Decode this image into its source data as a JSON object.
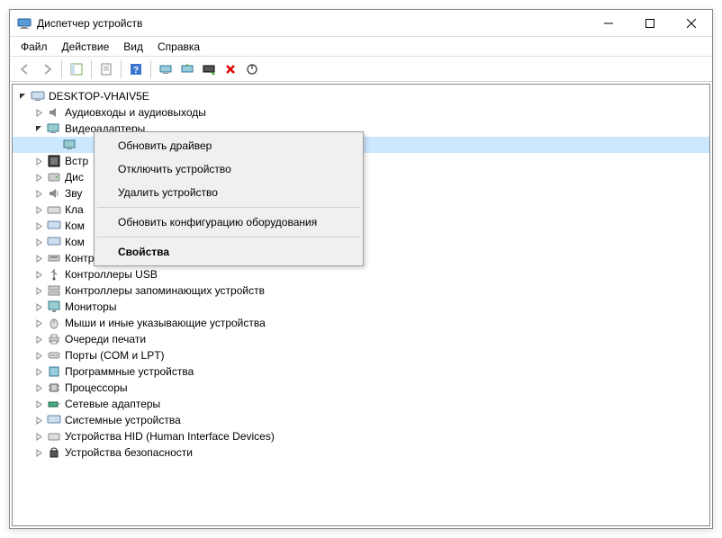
{
  "window": {
    "title": "Диспетчер устройств"
  },
  "menu": {
    "file": "Файл",
    "action": "Действие",
    "view": "Вид",
    "help": "Справка"
  },
  "tree": {
    "root": "DESKTOP-VHAIV5E",
    "nodes": [
      "Аудиовходы и аудиовыходы",
      "Видеоадаптеры",
      "Встр",
      "Дис",
      "Зву",
      "Кла",
      "Ком",
      "Ком",
      "Контроллеры IDE ATA/ATAPI",
      "Контроллеры USB",
      "Контроллеры запоминающих устройств",
      "Мониторы",
      "Мыши и иные указывающие устройства",
      "Очереди печати",
      "Порты (COM и LPT)",
      "Программные устройства",
      "Процессоры",
      "Сетевые адаптеры",
      "Системные устройства",
      "Устройства HID (Human Interface Devices)",
      "Устройства безопасности"
    ]
  },
  "ctx": {
    "update": "Обновить драйвер",
    "disable": "Отключить устройство",
    "uninstall": "Удалить устройство",
    "scan": "Обновить конфигурацию оборудования",
    "props": "Свойства"
  }
}
